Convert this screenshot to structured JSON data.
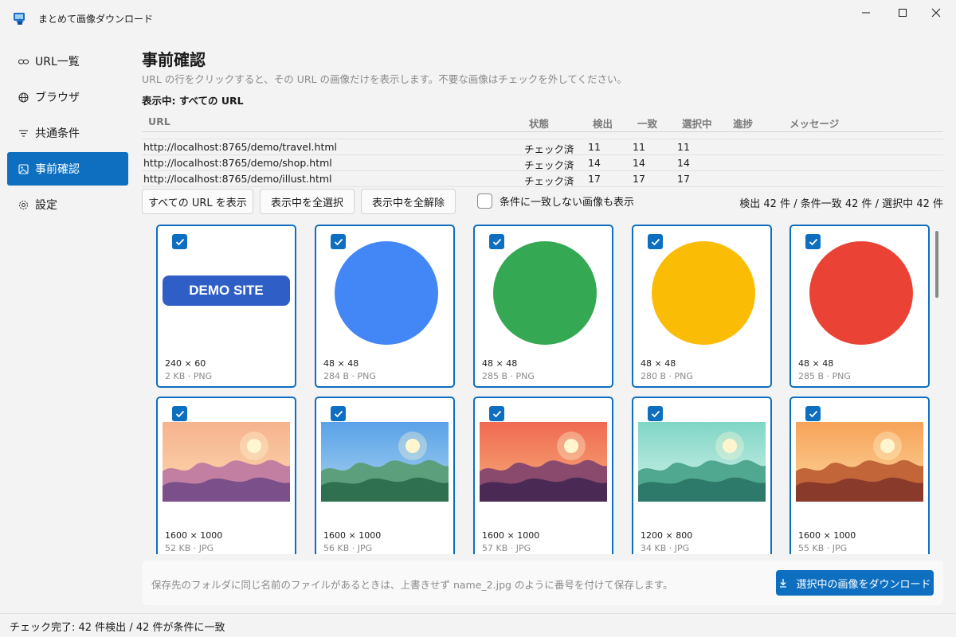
{
  "window": {
    "title": "まとめて画像ダウンロード"
  },
  "sidebar": {
    "items": [
      {
        "label": "URL一覧",
        "icon": "link-icon"
      },
      {
        "label": "ブラウザ",
        "icon": "globe-icon"
      },
      {
        "label": "共通条件",
        "icon": "filter-icon"
      },
      {
        "label": "事前確認",
        "icon": "image-icon",
        "active": true
      },
      {
        "label": "設定",
        "icon": "gear-icon"
      }
    ]
  },
  "main": {
    "title": "事前確認",
    "description": "URL の行をクリックすると、その URL の画像だけを表示します。不要な画像はチェックを外してください。",
    "showing": "表示中: すべての URL"
  },
  "url_table": {
    "headers": {
      "url": "URL",
      "status": "状態",
      "detected": "検出",
      "matched": "一致",
      "selected": "選択中",
      "progress": "進捗",
      "message": "メッセージ"
    },
    "rows": [
      {
        "url": "http://localhost:8765/demo/travel.html",
        "status": "チェック済",
        "detected": "11",
        "matched": "11",
        "selected": "11"
      },
      {
        "url": "http://localhost:8765/demo/shop.html",
        "status": "チェック済",
        "detected": "14",
        "matched": "14",
        "selected": "14"
      },
      {
        "url": "http://localhost:8765/demo/illust.html",
        "status": "チェック済",
        "detected": "17",
        "matched": "17",
        "selected": "17"
      }
    ]
  },
  "toolbar": {
    "show_all": "すべての URL を表示",
    "select_all": "表示中を全選択",
    "deselect_all": "表示中を全解除",
    "show_unmatched": "条件に一致しない画像も表示",
    "summary": "検出 42 件 / 条件一致 42 件 / 選択中 42 件"
  },
  "cards": [
    {
      "dims": "240 × 60",
      "meta": "2 KB · PNG",
      "kind": "banner",
      "banner_text": "DEMO SITE",
      "color": "#2f5fc6"
    },
    {
      "dims": "48 × 48",
      "meta": "284 B · PNG",
      "kind": "circle",
      "color": "#4287f5"
    },
    {
      "dims": "48 × 48",
      "meta": "285 B · PNG",
      "kind": "circle",
      "color": "#34a853"
    },
    {
      "dims": "48 × 48",
      "meta": "280 B · PNG",
      "kind": "circle",
      "color": "#fbbc05"
    },
    {
      "dims": "48 × 48",
      "meta": "285 B · PNG",
      "kind": "circle",
      "color": "#ea4335"
    },
    {
      "dims": "1600 × 1000",
      "meta": "52 KB · JPG",
      "kind": "landscape",
      "sky1": "#f6b38e",
      "sky2": "#fcd9b0",
      "back": "#c27fa2",
      "front": "#7a4f8a"
    },
    {
      "dims": "1600 × 1000",
      "meta": "56 KB · JPG",
      "kind": "landscape",
      "sky1": "#5aa2e8",
      "sky2": "#a9d4f0",
      "back": "#5c9f7c",
      "front": "#2f7050"
    },
    {
      "dims": "1600 × 1000",
      "meta": "57 KB · JPG",
      "kind": "landscape",
      "sky1": "#f06a52",
      "sky2": "#f6b07a",
      "back": "#8a4a6e",
      "front": "#4a2a55"
    },
    {
      "dims": "1200 × 800",
      "meta": "34 KB · JPG",
      "kind": "landscape",
      "sky1": "#7fd6c6",
      "sky2": "#d6f2ea",
      "back": "#4fa88f",
      "front": "#2e7a6a"
    },
    {
      "dims": "1600 × 1000",
      "meta": "55 KB · JPG",
      "kind": "landscape",
      "sky1": "#f7a35a",
      "sky2": "#fcd79c",
      "back": "#c2663a",
      "front": "#8a3a2a"
    }
  ],
  "footer": {
    "note": "保存先のフォルダに同じ名前のファイルがあるときは、上書きせず name_2.jpg のように番号を付けて保存します。",
    "download": "選択中の画像をダウンロード"
  },
  "status": "チェック完了: 42 件検出 / 42 件が条件に一致"
}
